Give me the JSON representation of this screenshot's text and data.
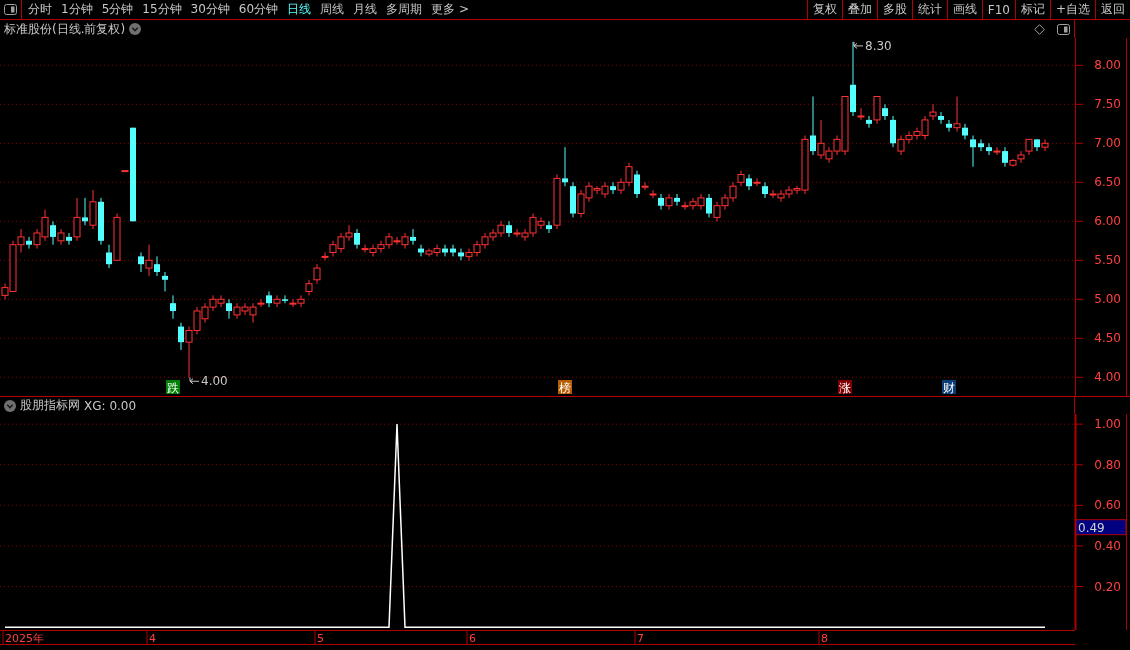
{
  "toolbar": {
    "periods": [
      {
        "label": "分时",
        "selected": false
      },
      {
        "label": "1分钟",
        "selected": false
      },
      {
        "label": "5分钟",
        "selected": false
      },
      {
        "label": "15分钟",
        "selected": false
      },
      {
        "label": "30分钟",
        "selected": false
      },
      {
        "label": "60分钟",
        "selected": false
      },
      {
        "label": "日线",
        "selected": true
      },
      {
        "label": "周线",
        "selected": false
      },
      {
        "label": "月线",
        "selected": false
      },
      {
        "label": "多周期",
        "selected": false
      },
      {
        "label": "更多 >",
        "selected": false
      }
    ],
    "buttons": [
      "复权",
      "叠加",
      "多股",
      "统计",
      "画线",
      "F10",
      "标记",
      "+自选",
      "返回"
    ]
  },
  "price_panel": {
    "title": "标准股份(日线.前复权)",
    "chart_data": {
      "type": "candlestick",
      "grid": true,
      "ylim": [
        3.76,
        8.35
      ],
      "yticks": [
        {
          "value": 4,
          "label": "4.00"
        },
        {
          "value": 4.5,
          "label": "4.50"
        },
        {
          "value": 5,
          "label": "5.00"
        },
        {
          "value": 5.5,
          "label": "5.50"
        },
        {
          "value": 6,
          "label": "6.00"
        },
        {
          "value": 6.5,
          "label": "6.50"
        },
        {
          "value": 7,
          "label": "7.00"
        },
        {
          "value": 7.5,
          "label": "7.50"
        },
        {
          "value": 8,
          "label": "8.00"
        }
      ],
      "ohlc": [
        [
          5.05,
          5.2,
          5.0,
          5.15
        ],
        [
          5.1,
          5.75,
          5.1,
          5.7
        ],
        [
          5.7,
          5.9,
          5.6,
          5.8
        ],
        [
          5.75,
          5.8,
          5.65,
          5.7
        ],
        [
          5.7,
          5.9,
          5.65,
          5.85
        ],
        [
          5.8,
          6.15,
          5.75,
          6.05
        ],
        [
          5.95,
          6.0,
          5.7,
          5.8
        ],
        [
          5.75,
          5.9,
          5.7,
          5.85
        ],
        [
          5.8,
          5.85,
          5.7,
          5.75
        ],
        [
          5.8,
          6.3,
          5.75,
          6.05
        ],
        [
          6.05,
          6.3,
          5.95,
          6.0
        ],
        [
          5.95,
          6.4,
          5.9,
          6.25
        ],
        [
          6.25,
          6.3,
          5.7,
          5.75
        ],
        [
          5.6,
          5.7,
          5.4,
          5.45
        ],
        [
          5.5,
          6.1,
          5.5,
          6.05
        ],
        [
          6.65,
          6.65,
          6.65,
          6.65
        ],
        [
          7.2,
          7.2,
          6.0,
          6.0
        ],
        [
          5.55,
          5.6,
          5.35,
          5.45
        ],
        [
          5.4,
          5.7,
          5.3,
          5.5
        ],
        [
          5.45,
          5.55,
          5.3,
          5.35
        ],
        [
          5.3,
          5.35,
          5.1,
          5.25
        ],
        [
          4.95,
          5.05,
          4.75,
          4.85
        ],
        [
          4.65,
          4.7,
          4.35,
          4.45
        ],
        [
          4.45,
          4.65,
          4.0,
          4.6
        ],
        [
          4.6,
          4.9,
          4.55,
          4.85
        ],
        [
          4.75,
          4.95,
          4.7,
          4.9
        ],
        [
          4.9,
          5.05,
          4.85,
          5.0
        ],
        [
          4.95,
          5.05,
          4.9,
          5.0
        ],
        [
          4.95,
          5.0,
          4.75,
          4.85
        ],
        [
          4.8,
          4.95,
          4.75,
          4.9
        ],
        [
          4.85,
          4.95,
          4.8,
          4.9
        ],
        [
          4.8,
          4.95,
          4.7,
          4.9
        ],
        [
          4.95,
          5.0,
          4.9,
          4.95
        ],
        [
          5.05,
          5.1,
          4.9,
          4.95
        ],
        [
          4.95,
          5.05,
          4.9,
          5.0
        ],
        [
          5.0,
          5.05,
          4.95,
          4.98
        ],
        [
          4.95,
          5.0,
          4.9,
          4.95
        ],
        [
          4.95,
          5.05,
          4.9,
          5.0
        ],
        [
          5.1,
          5.25,
          5.05,
          5.2
        ],
        [
          5.25,
          5.45,
          5.2,
          5.4
        ],
        [
          5.55,
          5.6,
          5.5,
          5.55
        ],
        [
          5.6,
          5.75,
          5.55,
          5.7
        ],
        [
          5.65,
          5.85,
          5.6,
          5.8
        ],
        [
          5.8,
          5.95,
          5.75,
          5.85
        ],
        [
          5.85,
          5.9,
          5.65,
          5.7
        ],
        [
          5.65,
          5.7,
          5.6,
          5.65
        ],
        [
          5.6,
          5.7,
          5.55,
          5.65
        ],
        [
          5.65,
          5.75,
          5.6,
          5.7
        ],
        [
          5.7,
          5.85,
          5.65,
          5.8
        ],
        [
          5.75,
          5.8,
          5.7,
          5.75
        ],
        [
          5.7,
          5.85,
          5.65,
          5.8
        ],
        [
          5.8,
          5.9,
          5.7,
          5.75
        ],
        [
          5.65,
          5.7,
          5.55,
          5.6
        ],
        [
          5.58,
          5.65,
          5.55,
          5.62
        ],
        [
          5.6,
          5.7,
          5.55,
          5.65
        ],
        [
          5.65,
          5.7,
          5.55,
          5.6
        ],
        [
          5.65,
          5.7,
          5.55,
          5.6
        ],
        [
          5.6,
          5.65,
          5.5,
          5.55
        ],
        [
          5.55,
          5.65,
          5.5,
          5.6
        ],
        [
          5.6,
          5.75,
          5.55,
          5.7
        ],
        [
          5.7,
          5.85,
          5.65,
          5.8
        ],
        [
          5.8,
          5.9,
          5.75,
          5.85
        ],
        [
          5.85,
          6.0,
          5.8,
          5.95
        ],
        [
          5.95,
          6.0,
          5.8,
          5.85
        ],
        [
          5.85,
          5.9,
          5.8,
          5.85
        ],
        [
          5.8,
          5.9,
          5.75,
          5.85
        ],
        [
          5.85,
          6.1,
          5.8,
          6.05
        ],
        [
          5.95,
          6.05,
          5.9,
          6.0
        ],
        [
          5.95,
          6.0,
          5.85,
          5.9
        ],
        [
          5.95,
          6.6,
          5.9,
          6.55
        ],
        [
          6.55,
          6.95,
          6.45,
          6.5
        ],
        [
          6.45,
          6.5,
          6.05,
          6.1
        ],
        [
          6.1,
          6.4,
          6.05,
          6.35
        ],
        [
          6.3,
          6.5,
          6.25,
          6.45
        ],
        [
          6.4,
          6.45,
          6.35,
          6.42
        ],
        [
          6.35,
          6.5,
          6.3,
          6.45
        ],
        [
          6.45,
          6.5,
          6.35,
          6.4
        ],
        [
          6.4,
          6.55,
          6.35,
          6.5
        ],
        [
          6.5,
          6.75,
          6.45,
          6.7
        ],
        [
          6.6,
          6.65,
          6.3,
          6.35
        ],
        [
          6.45,
          6.5,
          6.4,
          6.45
        ],
        [
          6.35,
          6.4,
          6.3,
          6.35
        ],
        [
          6.3,
          6.35,
          6.15,
          6.2
        ],
        [
          6.2,
          6.35,
          6.15,
          6.3
        ],
        [
          6.3,
          6.35,
          6.2,
          6.25
        ],
        [
          6.2,
          6.25,
          6.15,
          6.2
        ],
        [
          6.2,
          6.3,
          6.15,
          6.25
        ],
        [
          6.2,
          6.35,
          6.15,
          6.3
        ],
        [
          6.3,
          6.35,
          6.05,
          6.1
        ],
        [
          6.05,
          6.25,
          6.0,
          6.2
        ],
        [
          6.2,
          6.35,
          6.15,
          6.3
        ],
        [
          6.3,
          6.5,
          6.25,
          6.45
        ],
        [
          6.5,
          6.65,
          6.45,
          6.6
        ],
        [
          6.55,
          6.6,
          6.4,
          6.45
        ],
        [
          6.5,
          6.55,
          6.45,
          6.5
        ],
        [
          6.45,
          6.5,
          6.3,
          6.35
        ],
        [
          6.35,
          6.4,
          6.3,
          6.35
        ],
        [
          6.3,
          6.4,
          6.25,
          6.35
        ],
        [
          6.35,
          6.45,
          6.3,
          6.4
        ],
        [
          6.4,
          6.45,
          6.35,
          6.42
        ],
        [
          6.4,
          7.1,
          6.35,
          7.05
        ],
        [
          7.1,
          7.6,
          6.85,
          6.9
        ],
        [
          6.85,
          7.3,
          6.8,
          7.0
        ],
        [
          6.8,
          6.95,
          6.75,
          6.9
        ],
        [
          6.9,
          7.1,
          6.85,
          7.05
        ],
        [
          6.9,
          7.6,
          6.85,
          7.6
        ],
        [
          7.75,
          8.3,
          7.35,
          7.4
        ],
        [
          7.35,
          7.45,
          7.3,
          7.35
        ],
        [
          7.3,
          7.35,
          7.2,
          7.25
        ],
        [
          7.3,
          7.6,
          7.25,
          7.6
        ],
        [
          7.45,
          7.5,
          7.3,
          7.35
        ],
        [
          7.3,
          7.35,
          6.95,
          7.0
        ],
        [
          6.9,
          7.1,
          6.85,
          7.05
        ],
        [
          7.05,
          7.15,
          7.0,
          7.1
        ],
        [
          7.1,
          7.2,
          7.05,
          7.15
        ],
        [
          7.1,
          7.35,
          7.05,
          7.3
        ],
        [
          7.35,
          7.5,
          7.3,
          7.4
        ],
        [
          7.35,
          7.4,
          7.25,
          7.3
        ],
        [
          7.25,
          7.3,
          7.15,
          7.2
        ],
        [
          7.2,
          7.6,
          7.15,
          7.25
        ],
        [
          7.2,
          7.25,
          7.05,
          7.1
        ],
        [
          7.05,
          7.1,
          6.7,
          6.95
        ],
        [
          7.0,
          7.05,
          6.9,
          6.95
        ],
        [
          6.95,
          7.0,
          6.85,
          6.9
        ],
        [
          6.9,
          6.95,
          6.85,
          6.9
        ],
        [
          6.9,
          6.95,
          6.7,
          6.75
        ],
        [
          6.72,
          6.8,
          6.7,
          6.78
        ],
        [
          6.8,
          6.9,
          6.75,
          6.85
        ],
        [
          6.9,
          7.05,
          6.85,
          7.05
        ],
        [
          7.05,
          7.05,
          6.9,
          6.95
        ],
        [
          6.95,
          7.05,
          6.9,
          7.0
        ]
      ]
    },
    "high_label": "8.30",
    "low_label": "4.00",
    "signals": [
      {
        "label": "跌",
        "color": "#008000"
      },
      {
        "label": "榜",
        "color": "#b85c00"
      },
      {
        "label": "涨",
        "color": "#800000"
      },
      {
        "label": "财",
        "color": "#0a3c78"
      }
    ]
  },
  "indicator_panel": {
    "name": "股朋指标网",
    "reading": "XG: 0.00",
    "cursor_value": "0.49",
    "chart_data": {
      "type": "line",
      "grid": true,
      "ylim": [
        -0.014,
        1.05
      ],
      "yticks": [
        {
          "value": 0.2,
          "label": "0.20"
        },
        {
          "value": 0.4,
          "label": "0.40"
        },
        {
          "value": 0.6,
          "label": "0.60"
        },
        {
          "value": 0.8,
          "label": "0.80"
        },
        {
          "value": 1,
          "label": "1.00"
        }
      ],
      "series": [
        {
          "color": "#ffffff",
          "values": [
            0,
            0,
            0,
            0,
            0,
            0,
            0,
            0,
            0,
            0,
            0,
            0,
            0,
            0,
            0,
            0,
            0,
            0,
            0,
            0,
            0,
            0,
            0,
            0,
            0,
            0,
            0,
            0,
            0,
            0,
            0,
            0,
            0,
            0,
            0,
            0,
            0,
            0,
            0,
            0,
            0,
            0,
            0,
            0,
            0,
            0,
            0,
            0,
            0,
            1,
            0,
            0,
            0,
            0,
            0,
            0,
            0,
            0,
            0,
            0,
            0,
            0,
            0,
            0,
            0,
            0,
            0,
            0,
            0,
            0,
            0,
            0,
            0,
            0,
            0,
            0,
            0,
            0,
            0,
            0,
            0,
            0,
            0,
            0,
            0,
            0,
            0,
            0,
            0,
            0,
            0,
            0,
            0,
            0,
            0,
            0,
            0,
            0,
            0,
            0,
            0,
            0,
            0,
            0,
            0,
            0,
            0,
            0,
            0,
            0,
            0,
            0,
            0,
            0,
            0,
            0,
            0,
            0,
            0,
            0,
            0,
            0,
            0,
            0,
            0,
            0,
            0,
            0,
            0,
            0,
            0
          ]
        }
      ]
    },
    "date_axis": [
      {
        "label": "2025年"
      },
      {
        "label": "4"
      },
      {
        "label": "5"
      },
      {
        "label": "6"
      },
      {
        "label": "7"
      },
      {
        "label": "8"
      }
    ]
  }
}
